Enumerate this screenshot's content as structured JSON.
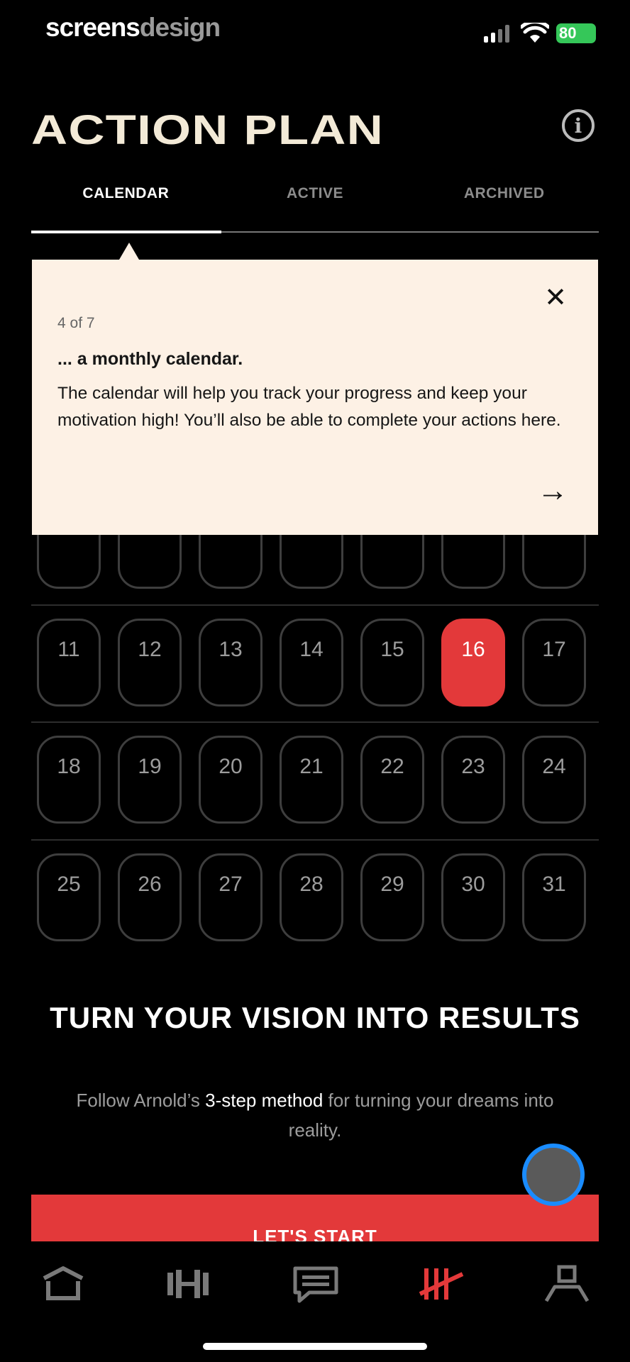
{
  "status_bar": {
    "brand_part1": "screens",
    "brand_part2": "design",
    "battery": "80"
  },
  "header": {
    "title": "ACTION PLAN",
    "info_icon": "info-circle-icon"
  },
  "tabs": [
    {
      "label": "CALENDAR",
      "active": true
    },
    {
      "label": "ACTIVE",
      "active": false
    },
    {
      "label": "ARCHIVED",
      "active": false
    }
  ],
  "calendar": {
    "selected_day": "16",
    "rows": [
      [
        "11",
        "12",
        "13",
        "14",
        "15",
        "16",
        "17"
      ],
      [
        "18",
        "19",
        "20",
        "21",
        "22",
        "23",
        "24"
      ],
      [
        "25",
        "26",
        "27",
        "28",
        "29",
        "30",
        "31"
      ]
    ]
  },
  "popover": {
    "step": "4 of 7",
    "heading": "... a monthly calendar.",
    "body": "The calendar will help you track your progress and keep your motivation high! You’ll also be able to complete your actions here.",
    "close_icon": "close-icon",
    "next_icon": "arrow-right-icon"
  },
  "promo": {
    "title": "TURN YOUR VISION INTO RESULTS",
    "sub_before": "Follow Arnold’s ",
    "sub_highlight": "3-step method",
    "sub_after": " for turning your dreams into reality.",
    "cta": "LET'S START"
  },
  "bottom_nav": [
    {
      "icon": "home-icon",
      "active": false
    },
    {
      "icon": "dumbbell-icon",
      "active": false
    },
    {
      "icon": "chat-icon",
      "active": false
    },
    {
      "icon": "tally-icon",
      "active": true
    },
    {
      "icon": "profile-icon",
      "active": false
    }
  ],
  "colors": {
    "accent": "#e3393a",
    "popover_bg": "#fdf1e5",
    "background": "#000000"
  }
}
